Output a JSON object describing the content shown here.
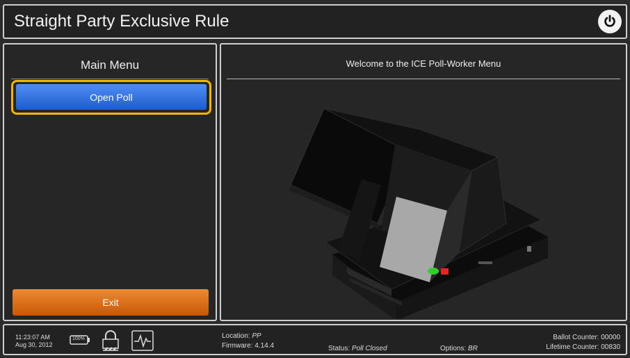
{
  "title_bar": {
    "title": "Straight Party Exclusive Rule"
  },
  "left_panel": {
    "heading": "Main Menu",
    "open_poll_label": "Open Poll",
    "exit_label": "Exit"
  },
  "right_panel": {
    "heading": "Welcome to the ICE Poll-Worker Menu"
  },
  "status_bar": {
    "time": "11:23:07 AM",
    "date": "Aug 30, 2012",
    "battery_label": "100%",
    "location_label": "Location:",
    "location_value": "PP",
    "firmware_label": "Firmware:",
    "firmware_value": "4.14.4",
    "status_label": "Status:",
    "status_value": "Poll Closed",
    "options_label": "Options:",
    "options_value": "BR",
    "ballot_counter": "Ballot Counter: 00000",
    "lifetime_counter": "Lifetime Counter: 00830"
  },
  "colors": {
    "open_poll_blue": "#2f6fe0",
    "exit_orange": "#e06f13",
    "focus_ring_yellow": "#f5b600"
  }
}
